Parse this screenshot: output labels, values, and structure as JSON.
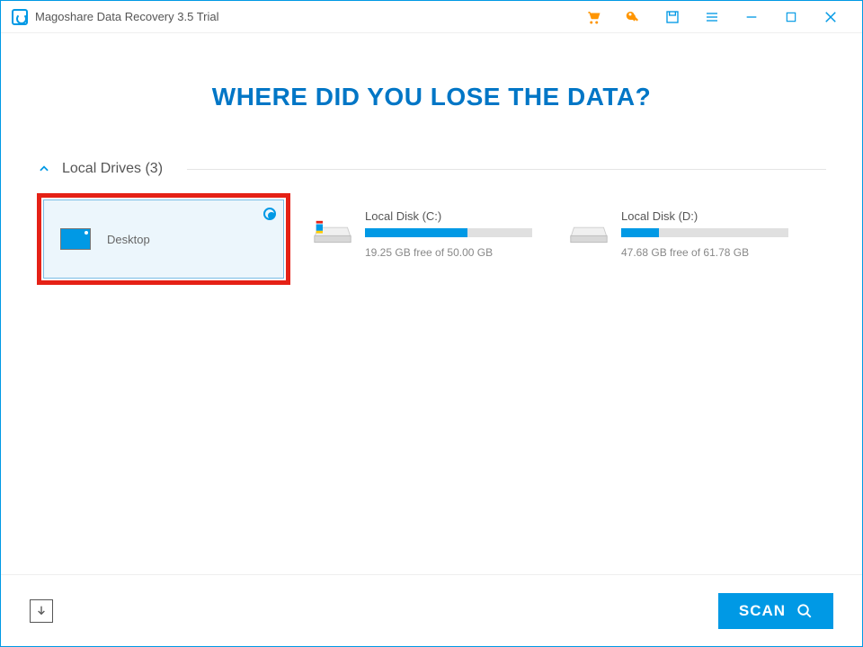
{
  "app": {
    "title": "Magoshare Data Recovery 3.5 Trial"
  },
  "heading": "WHERE DID YOU LOSE THE DATA?",
  "section": {
    "title": "Local Drives (3)"
  },
  "drives": {
    "selected": {
      "name": "Desktop"
    },
    "disk_c": {
      "label": "Local Disk (C:)",
      "free_text": "19.25 GB free of 50.00 GB",
      "used_pct": 61.5
    },
    "disk_d": {
      "label": "Local Disk (D:)",
      "free_text": "47.68 GB free of 61.78 GB",
      "used_pct": 22.8
    }
  },
  "buttons": {
    "scan": "SCAN"
  }
}
